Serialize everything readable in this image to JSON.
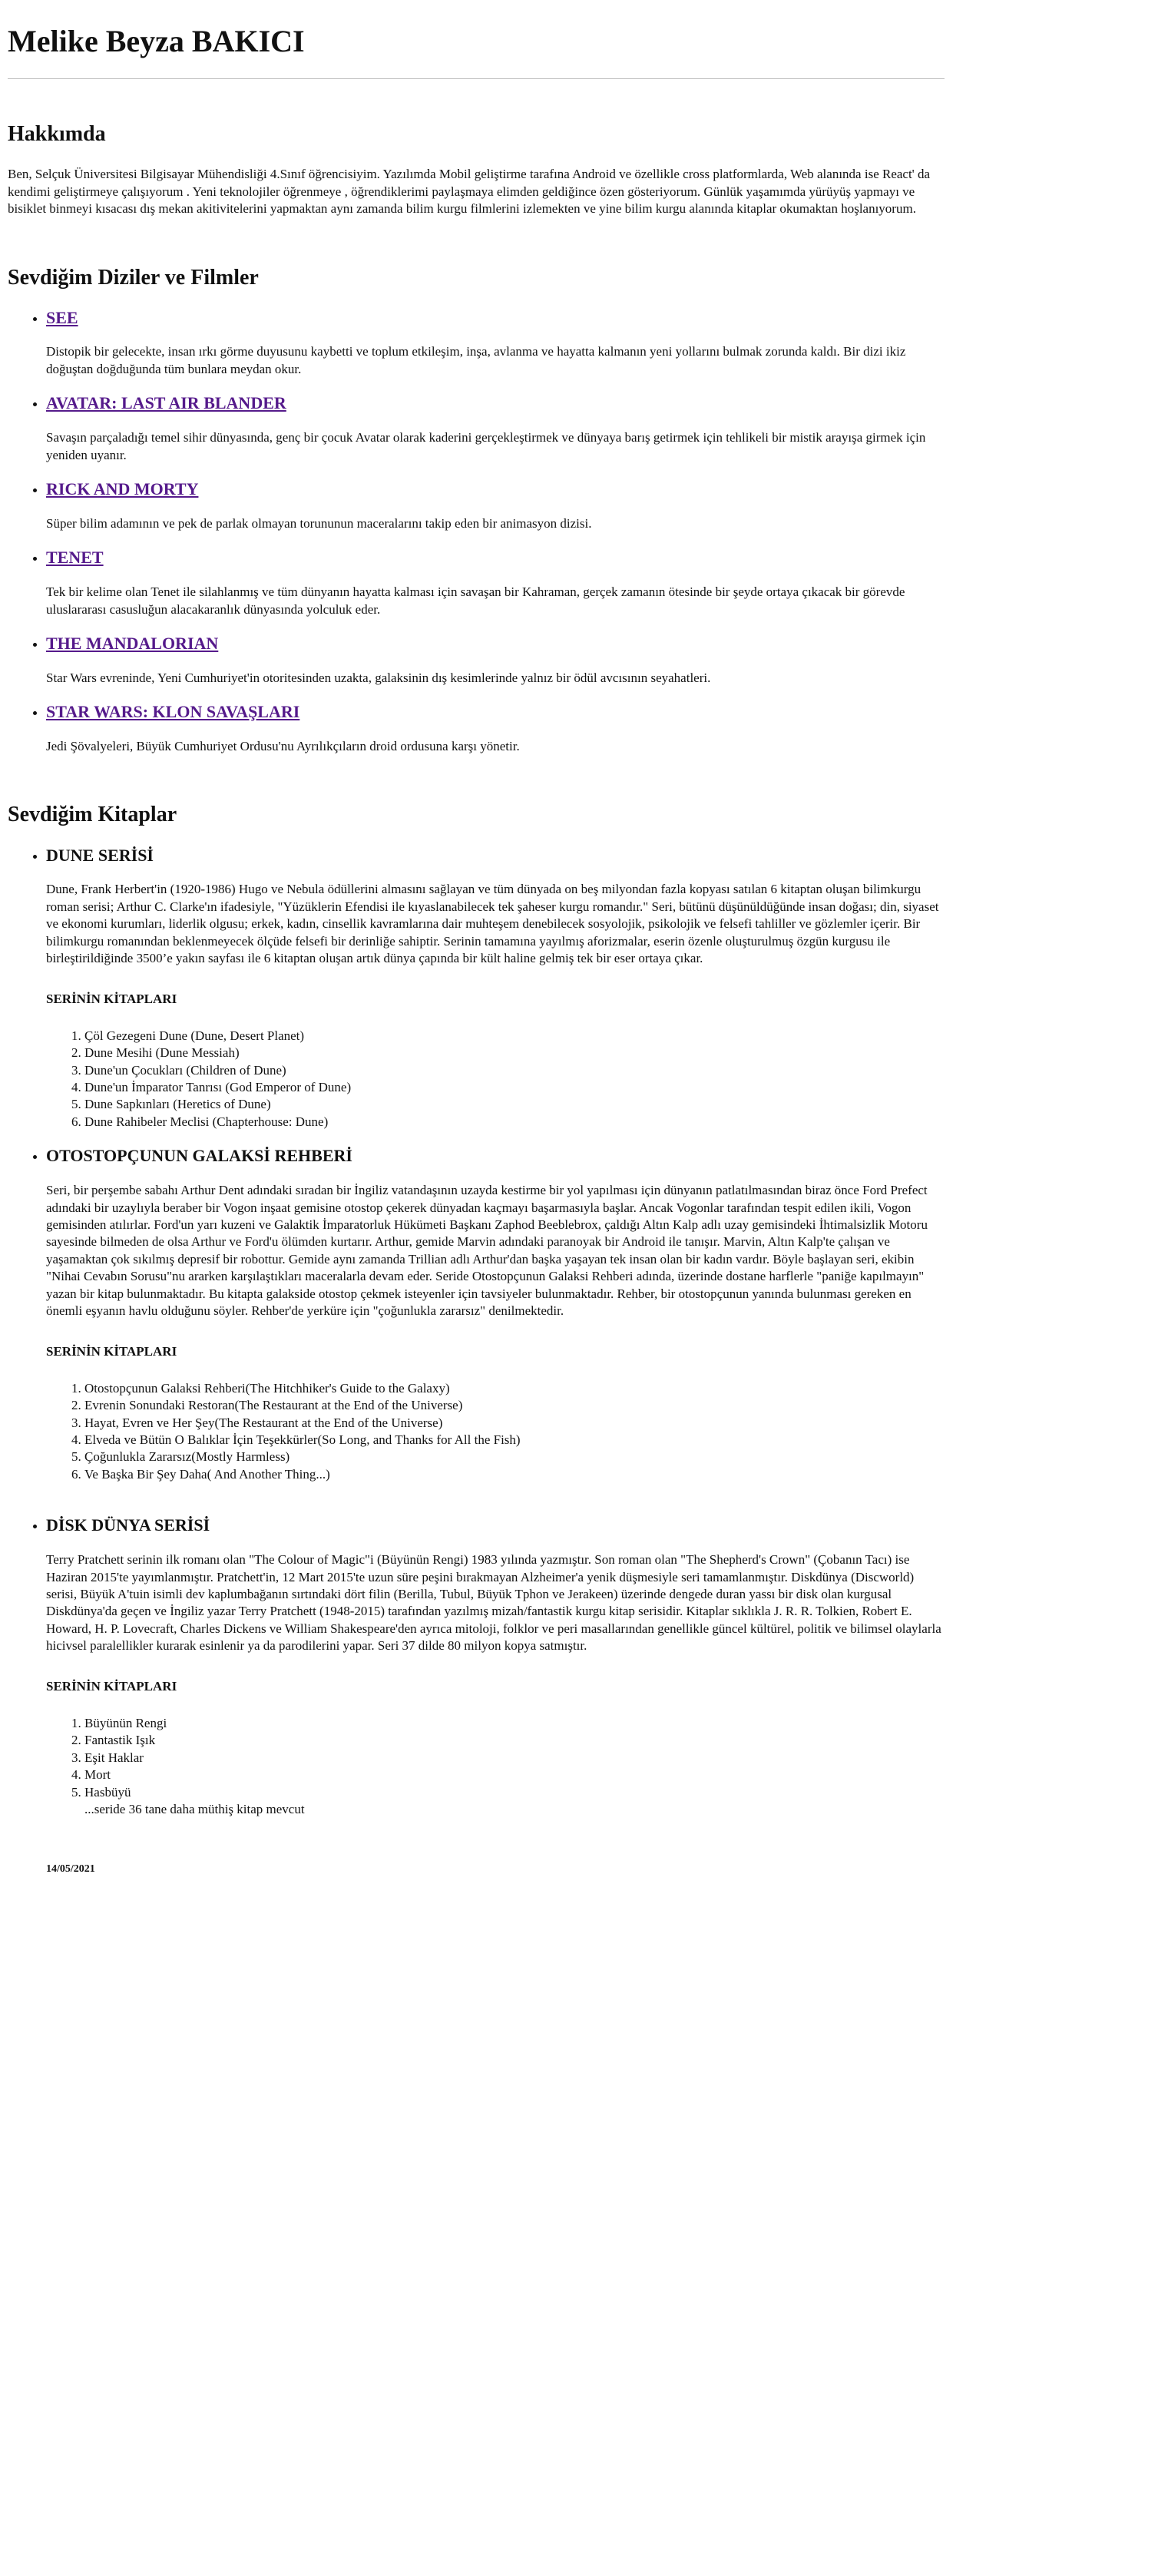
{
  "header": {
    "name": "Melike Beyza BAKICI"
  },
  "about": {
    "title": "Hakkımda",
    "text": "Ben, Selçuk Üniversitesi Bilgisayar Mühendisliği 4.Sınıf öğrencisiyim. Yazılımda Mobil geliştirme tarafına Android ve özellikle cross platformlarda, Web alanında ise React' da kendimi geliştirmeye çalışıyorum . Yeni teknolojiler öğrenmeye , öğrendiklerimi paylaşmaya elimden geldiğince özen gösteriyorum. Günlük yaşamımda yürüyüş yapmayı ve bisiklet binmeyi kısacası dış mekan akitivitelerini yapmaktan aynı zamanda bilim kurgu filmlerini izlemekten ve yine bilim kurgu alanında kitaplar okumaktan hoşlanıyorum."
  },
  "shows": {
    "title": "Sevdiğim Diziler ve Filmler",
    "items": [
      {
        "name": "SEE",
        "description": "Distopik bir gelecekte, insan ırkı görme duyusunu kaybetti ve toplum etkileşim, inşa, avlanma ve hayatta kalmanın yeni yollarını bulmak zorunda kaldı. Bir dizi ikiz doğuştan doğduğunda tüm bunlara meydan okur."
      },
      {
        "name": "AVATAR: LAST AIR BLANDER",
        "description": "Savaşın parçaladığı temel sihir dünyasında, genç bir çocuk Avatar olarak kaderini gerçekleştirmek ve dünyaya barış getirmek için tehlikeli bir mistik arayışa girmek için yeniden uyanır."
      },
      {
        "name": "RICK AND MORTY",
        "description": "Süper bilim adamının ve pek de parlak olmayan torununun maceralarını takip eden bir animasyon dizisi."
      },
      {
        "name": "TENET",
        "description": "Tek bir kelime olan Tenet ile silahlanmış ve tüm dünyanın hayatta kalması için savaşan bir Kahraman, gerçek zamanın ötesinde bir şeyde ortaya çıkacak bir görevde uluslararası casusluğun alacakaranlık dünyasında yolculuk eder."
      },
      {
        "name": "THE MANDALORIAN",
        "description": "Star Wars evreninde, Yeni Cumhuriyet'in otoritesinden uzakta, galaksinin dış kesimlerinde yalnız bir ödül avcısının seyahatleri."
      },
      {
        "name": "STAR WARS: KLON SAVAŞLARI",
        "description": "Jedi Şövalyeleri, Büyük Cumhuriyet Ordusu'nu Ayrılıkçıların droid ordusuna karşı yönetir."
      }
    ]
  },
  "books": {
    "title": "Sevdiğim Kitaplar",
    "series_heading": "SERİNİN KİTAPLARI",
    "dune": {
      "title": "DUNE SERİSİ",
      "description": "Dune, Frank Herbert'in (1920-1986) Hugo ve Nebula ödüllerini almasını sağlayan ve tüm dünyada on beş milyondan fazla kopyası satılan 6 kitaptan oluşan bilimkurgu roman serisi; Arthur C. Clarke'ın ifadesiyle, \"Yüzüklerin Efendisi ile kıyaslanabilecek tek şaheser kurgu romandır.\" Seri, bütünü düşünüldüğünde insan doğası; din, siyaset ve ekonomi kurumları, liderlik olgusu; erkek, kadın, cinsellik kavramlarına dair muhteşem denebilecek sosyolojik, psikolojik ve felsefi tahliller ve gözlemler içerir. Bir bilimkurgu romanından beklenmeyecek ölçüde felsefi bir derinliğe sahiptir. Serinin tamamına yayılmış aforizmalar, eserin özenle oluşturulmuş özgün kurgusu ile birleştirildiğinde 3500’e yakın sayfası ile 6 kitaptan oluşan artık dünya çapında bir kült haline gelmiş tek bir eser ortaya çıkar.",
      "books": [
        "Çöl Gezegeni Dune (Dune, Desert Planet)",
        "Dune Mesihi (Dune Messiah)",
        "Dune'un Çocukları (Children of Dune)",
        "Dune'un İmparator Tanrısı (God Emperor of Dune)",
        "Dune Sapkınları (Heretics of Dune)",
        "Dune Rahibeler Meclisi (Chapterhouse: Dune)"
      ]
    },
    "hitchhiker": {
      "title": "OTOSTOPÇUNUN GALAKSİ REHBERİ",
      "description": "Seri, bir perşembe sabahı Arthur Dent adındaki sıradan bir İngiliz vatandaşının uzayda kestirme bir yol yapılması için dünyanın patlatılmasından biraz önce Ford Prefect adındaki bir uzaylıyla beraber bir Vogon inşaat gemisine otostop çekerek dünyadan kaçmayı başarmasıyla başlar. Ancak Vogonlar tarafından tespit edilen ikili, Vogon gemisinden atılırlar. Ford'un yarı kuzeni ve Galaktik İmparatorluk Hükümeti Başkanı Zaphod Beeblebrox, çaldığı Altın Kalp adlı uzay gemisindeki İhtimalsizlik Motoru sayesinde bilmeden de olsa Arthur ve Ford'u ölümden kurtarır. Arthur, gemide Marvin adındaki paranoyak bir Android ile tanışır. Marvin, Altın Kalp'te çalışan ve yaşamaktan çok sıkılmış depresif bir robottur. Gemide aynı zamanda Trillian adlı Arthur'dan başka yaşayan tek insan olan bir kadın vardır. Böyle başlayan seri, ekibin \"Nihai Cevabın Sorusu\"nu ararken karşılaştıkları maceralarla devam eder. Seride Otostopçunun Galaksi Rehberi adında, üzerinde dostane harflerle \"paniğe kapılmayın\" yazan bir kitap bulunmaktadır. Bu kitapta galakside otostop çekmek isteyenler için tavsiyeler bulunmaktadır. Rehber, bir otostopçunun yanında bulunması gereken en önemli eşyanın havlu olduğunu söyler. Rehber'de yerküre için \"çoğunlukla zararsız\" denilmektedir.",
      "books": [
        "Otostopçunun Galaksi Rehberi(The Hitchhiker's Guide to the Galaxy)",
        "Evrenin Sonundaki Restoran(The Restaurant at the End of the Universe)",
        "Hayat, Evren ve Her Şey(The Restaurant at the End of the Universe)",
        "Elveda ve Bütün O Balıklar İçin Teşekkürler(So Long, and Thanks for All the Fish)",
        "Çoğunlukla Zararsız(Mostly Harmless)",
        "Ve Başka Bir Şey Daha( And Another Thing...)"
      ]
    },
    "discworld": {
      "title": "DİSK DÜNYA SERİSİ",
      "description": "Terry Pratchett serinin ilk romanı olan \"The Colour of Magic\"i (Büyünün Rengi) 1983 yılında yazmıştır. Son roman olan \"The Shepherd's Crown\" (Çobanın Tacı) ise Haziran 2015'te yayımlanmıştır. Pratchett'in, 12 Mart 2015'te uzun süre peşini bırakmayan Alzheimer'a yenik düşmesiyle seri tamamlanmıştır. Diskdünya (Discworld) serisi, Büyük A'tuin isimli dev kaplumbağanın sırtındaki dört filin (Berilla, Tubul, Büyük Tphon ve Jerakeen) üzerinde dengede duran yassı bir disk olan kurgusal Diskdünya'da geçen ve İngiliz yazar Terry Pratchett (1948-2015) tarafından yazılmış mizah/fantastik kurgu kitap serisidir. Kitaplar sıklıkla J. R. R. Tolkien, Robert E. Howard, H. P. Lovecraft, Charles Dickens ve William Shakespeare'den ayrıca mitoloji, folklor ve peri masallarından genellikle güncel kültürel, politik ve bilimsel olaylarla hicivsel paralellikler kurarak esinlenir ya da parodilerini yapar. Seri 37 dilde 80 milyon kopya satmıştır.",
      "books": [
        "Büyünün Rengi",
        "Fantastik Işık",
        "Eşit Haklar",
        "Mort",
        "Hasbüyü"
      ],
      "more": "...seride 36 tane daha müthiş kitap mevcut"
    }
  },
  "footer": {
    "date": "14/05/2021"
  }
}
